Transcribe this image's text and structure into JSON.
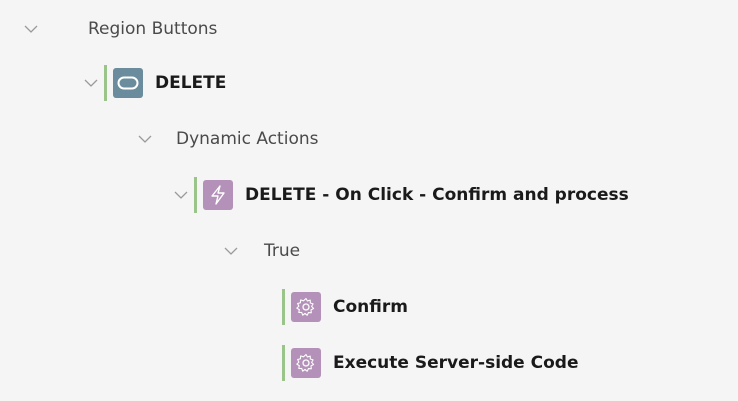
{
  "tree": {
    "region_buttons": {
      "label": "Region Buttons"
    },
    "delete_button": {
      "label": "DELETE"
    },
    "dynamic_actions": {
      "label": "Dynamic Actions"
    },
    "da_node": {
      "label": "DELETE - On Click - Confirm and process"
    },
    "true_branch": {
      "label": "True"
    },
    "actions": [
      {
        "label": "Confirm",
        "icon": "gear-icon"
      },
      {
        "label": "Execute Server-side Code",
        "icon": "gear-icon"
      }
    ]
  },
  "colors": {
    "background": "#f5f5f5",
    "selection_bar": "#9bc48b",
    "button_icon_bg": "#6b8c9c",
    "action_icon_bg": "#b491b8"
  }
}
